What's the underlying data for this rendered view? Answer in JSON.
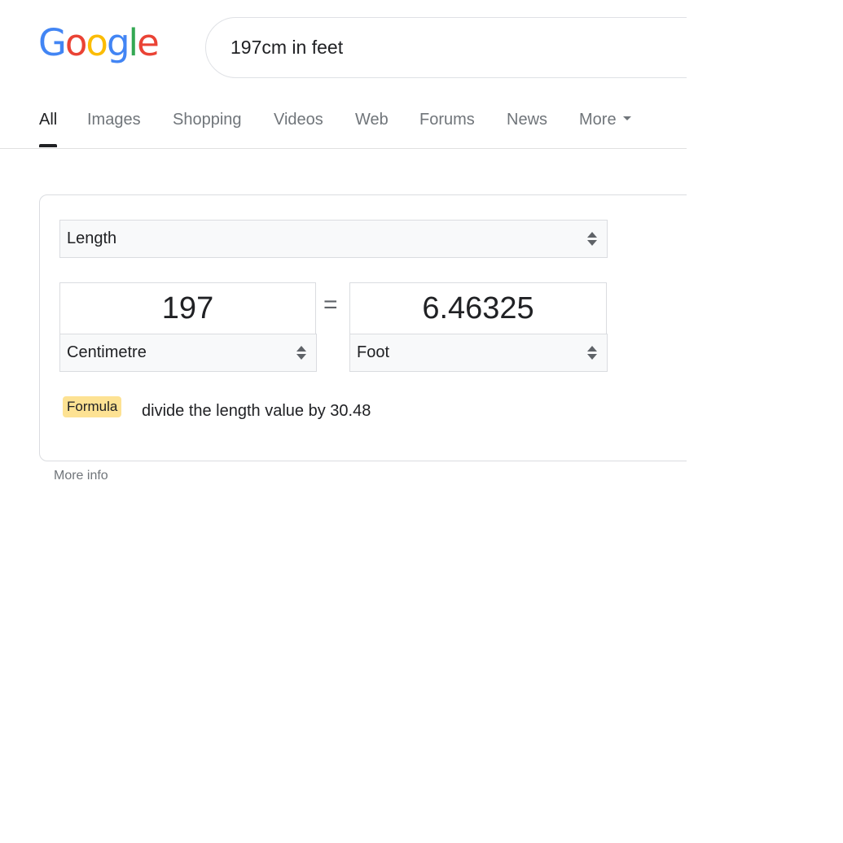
{
  "logo": {
    "letters": [
      {
        "ch": "G",
        "color": "#4285F4"
      },
      {
        "ch": "o",
        "color": "#EA4335"
      },
      {
        "ch": "o",
        "color": "#FBBC05"
      },
      {
        "ch": "g",
        "color": "#4285F4"
      },
      {
        "ch": "l",
        "color": "#34A853"
      },
      {
        "ch": "e",
        "color": "#EA4335"
      }
    ]
  },
  "search": {
    "query": "197cm in feet"
  },
  "tabs": [
    {
      "label": "All",
      "active": true
    },
    {
      "label": "Images"
    },
    {
      "label": "Shopping"
    },
    {
      "label": "Videos"
    },
    {
      "label": "Web"
    },
    {
      "label": "Forums"
    },
    {
      "label": "News"
    },
    {
      "label": "More",
      "icon": "caret-down-icon"
    }
  ],
  "converter": {
    "category": "Length",
    "from": {
      "value": "197",
      "unit": "Centimetre"
    },
    "equals": "=",
    "to": {
      "value": "6.46325",
      "unit": "Foot"
    },
    "formula_badge": "Formula",
    "formula_text": "divide the length value by 30.48"
  },
  "more_info": "More info",
  "colors": {
    "formula_badge_bg": "#fde293",
    "active_tab": "#202124",
    "inactive_tab": "#70757a"
  }
}
